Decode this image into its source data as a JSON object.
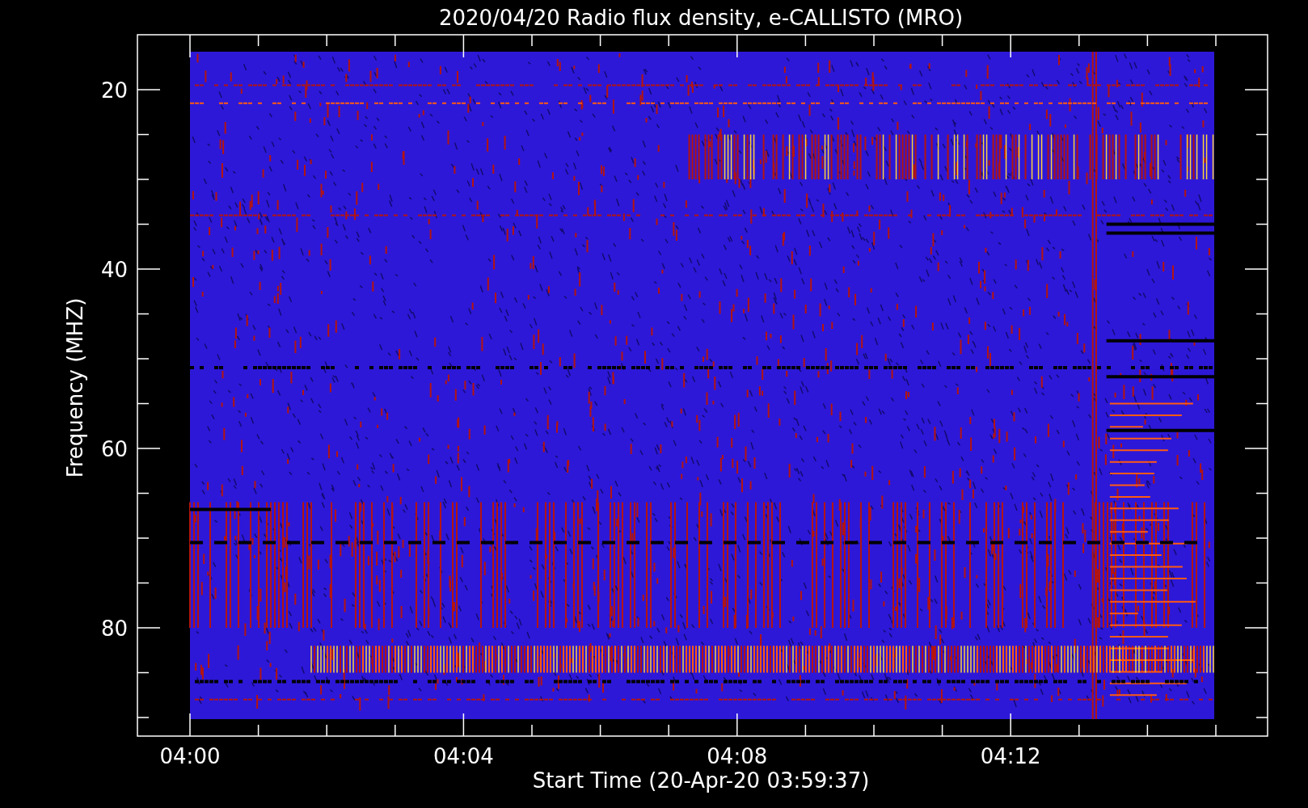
{
  "title": "2020/04/20  Radio flux density, e-CALLISTO (MRO)",
  "y_axis": {
    "label": "Frequency (MHZ)",
    "ticks": [
      "20",
      "40",
      "60",
      "80"
    ]
  },
  "x_axis": {
    "label": "Start Time (20-Apr-20 03:59:37)",
    "ticks": [
      "04:00",
      "04:04",
      "04:08",
      "04:12"
    ]
  }
}
